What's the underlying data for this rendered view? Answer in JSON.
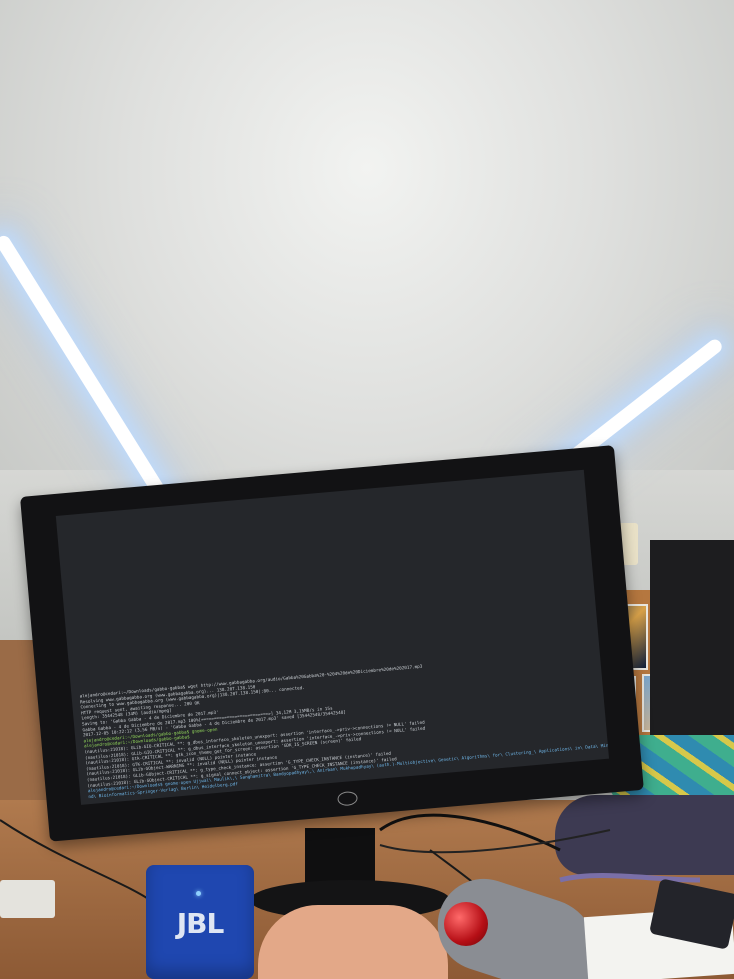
{
  "photo": {
    "terminal_lines": [
      "alejandro@cedari:~/Downloads/gabbo-gabba$ wget http://www.gabbagabba.org/audio/Gabba%20Gabba%20-%204%20de%20Diciembre%20de%202017.mp3",
      "Resolving www.gabbagabba.org (www.gabbagabba.org)... 138.207.138.150",
      "Connecting to www.gabbagabba.org (www.gabbagabba.org)|138.207.138.150|:80... connected.",
      "HTTP request sent, awaiting response... 200 OK",
      "Length: 35442548 (34M) [audio/mpeg]",
      "Saving to: 'Gabba Gabba - 4 de Diciembre de 2017.mp3'",
      "Gabba Gabba - 4 de Diciembre de 2017.mp3  100%[==========================>]  34,12M  3,15MB/s   in 15s",
      "2017-12-05 10:22:12 (3,56 MB/s) - 'Gabba Gabba - 4 de Diciembre de 2017.mp3' saved [35442548/35442548]",
      "alejandro@cedari:~/Downloads/gabbo-gabba$ gnome-open",
      "alejandro@cedari:~/Downloads/gabbo-gabba$",
      "(nautilus:21018): GLib-GIO-CRITICAL **: g_dbus_interface_skeleton_unexport: assertion 'interface_->priv->connections != NULL' failed",
      "(nautilus:21018): GLib-GIO-CRITICAL **: g_dbus_interface_skeleton_unexport: assertion 'interface_->priv->connections != NULL' failed",
      "(nautilus:21018): Gtk-CRITICAL **: gtk_icon_theme_get_for_screen: assertion 'GDK_IS_SCREEN (screen)' failed",
      "(nautilus:21018): GTK-CRITICAL **: invalid (NULL) pointer instance",
      "(nautilus:21018): GLib-GObject-WARNING **: invalid (NULL) pointer instance",
      "(nautilus:21018): GLib-GObject-CRITICAL **: g_type_check_instance: assertion 'G_TYPE_CHECK_INSTANCE (instance)' failed",
      "(nautilus:21018): GLib-GObject-CRITICAL **: g_signal_connect_object: assertion 'G_TYPE_CHECK_INSTANCE (instance)' failed",
      "alejandro@cedari:~/Downloads$ gnome-open Ujjwal\\ Maulik\\,\\ Sanghamitra\\ Bandyopadhyay\\,\\ Anirban\\ Mukhopadhyay\\ (auth.)-Multiobjective\\ Genetic\\ Algorithms\\ for\\ Clustering_\\ Applications\\ in\\ Data\\ Mining\\ a",
      "nd\\ Bioinformatics-Springer-Verlag\\ Berlin\\ Heidelberg.pdf"
    ],
    "speaker_brand": "JBL",
    "colors": {
      "screen_bg": "#25272b",
      "speaker": "#1f47b0",
      "trackball": "#c2161d"
    }
  }
}
